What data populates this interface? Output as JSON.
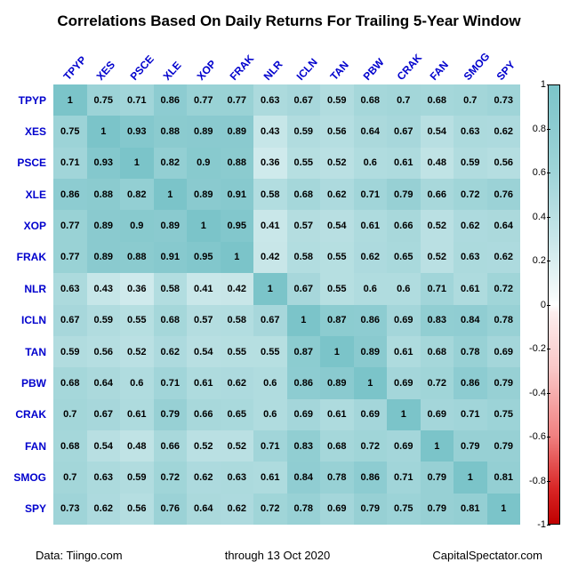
{
  "chart_data": {
    "type": "heatmap",
    "title": "Correlations Based On Daily Returns For Trailing 5-Year Window",
    "x_labels": [
      "TPYP",
      "XES",
      "PSCE",
      "XLE",
      "XOP",
      "FRAK",
      "NLR",
      "ICLN",
      "TAN",
      "PBW",
      "CRAK",
      "FAN",
      "SMOG",
      "SPY"
    ],
    "y_labels": [
      "TPYP",
      "XES",
      "PSCE",
      "XLE",
      "XOP",
      "FRAK",
      "NLR",
      "ICLN",
      "TAN",
      "PBW",
      "CRAK",
      "FAN",
      "SMOG",
      "SPY"
    ],
    "values": [
      [
        1,
        0.75,
        0.71,
        0.86,
        0.77,
        0.77,
        0.63,
        0.67,
        0.59,
        0.68,
        0.7,
        0.68,
        0.7,
        0.73
      ],
      [
        0.75,
        1,
        0.93,
        0.88,
        0.89,
        0.89,
        0.43,
        0.59,
        0.56,
        0.64,
        0.67,
        0.54,
        0.63,
        0.62
      ],
      [
        0.71,
        0.93,
        1,
        0.82,
        0.9,
        0.88,
        0.36,
        0.55,
        0.52,
        0.6,
        0.61,
        0.48,
        0.59,
        0.56
      ],
      [
        0.86,
        0.88,
        0.82,
        1,
        0.89,
        0.91,
        0.58,
        0.68,
        0.62,
        0.71,
        0.79,
        0.66,
        0.72,
        0.76
      ],
      [
        0.77,
        0.89,
        0.9,
        0.89,
        1,
        0.95,
        0.41,
        0.57,
        0.54,
        0.61,
        0.66,
        0.52,
        0.62,
        0.64
      ],
      [
        0.77,
        0.89,
        0.88,
        0.91,
        0.95,
        1,
        0.42,
        0.58,
        0.55,
        0.62,
        0.65,
        0.52,
        0.63,
        0.62
      ],
      [
        0.63,
        0.43,
        0.36,
        0.58,
        0.41,
        0.42,
        1,
        0.67,
        0.55,
        0.6,
        0.6,
        0.71,
        0.61,
        0.72
      ],
      [
        0.67,
        0.59,
        0.55,
        0.68,
        0.57,
        0.58,
        0.67,
        1,
        0.87,
        0.86,
        0.69,
        0.83,
        0.84,
        0.78
      ],
      [
        0.59,
        0.56,
        0.52,
        0.62,
        0.54,
        0.55,
        0.55,
        0.87,
        1,
        0.89,
        0.61,
        0.68,
        0.78,
        0.69
      ],
      [
        0.68,
        0.64,
        0.6,
        0.71,
        0.61,
        0.62,
        0.6,
        0.86,
        0.89,
        1,
        0.69,
        0.72,
        0.86,
        0.79
      ],
      [
        0.7,
        0.67,
        0.61,
        0.79,
        0.66,
        0.65,
        0.6,
        0.69,
        0.61,
        0.69,
        1,
        0.69,
        0.71,
        0.75
      ],
      [
        0.68,
        0.54,
        0.48,
        0.66,
        0.52,
        0.52,
        0.71,
        0.83,
        0.68,
        0.72,
        0.69,
        1,
        0.79,
        0.79
      ],
      [
        0.7,
        0.63,
        0.59,
        0.72,
        0.62,
        0.63,
        0.61,
        0.84,
        0.78,
        0.86,
        0.71,
        0.79,
        1,
        0.81
      ],
      [
        0.73,
        0.62,
        0.56,
        0.76,
        0.64,
        0.62,
        0.72,
        0.78,
        0.69,
        0.79,
        0.75,
        0.79,
        0.81,
        1
      ]
    ],
    "colorbar": {
      "min": -1,
      "max": 1,
      "ticks": [
        1,
        0.8,
        0.6,
        0.4,
        0.2,
        0,
        -0.2,
        -0.4,
        -0.6,
        -0.8,
        -1
      ]
    }
  },
  "footer": {
    "source": "Data: Tiingo.com",
    "date": "through 13 Oct 2020",
    "credit": "CapitalSpectator.com"
  }
}
